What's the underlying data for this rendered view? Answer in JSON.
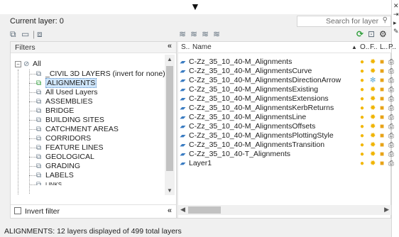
{
  "header": {
    "current_layer": "Current layer: 0",
    "search_placeholder": "Search for layer"
  },
  "filters": {
    "title": "Filters",
    "collapse": "«",
    "invert_filter": "Invert filter",
    "items": [
      {
        "label": "All"
      },
      {
        "label": "_CIVIL 3D LAYERS (invert for none)"
      },
      {
        "label": "ALIGNMENTS"
      },
      {
        "label": "All Used Layers"
      },
      {
        "label": "ASSEMBLIES"
      },
      {
        "label": "BRIDGE"
      },
      {
        "label": "BUILDING SITES"
      },
      {
        "label": "CATCHMENT AREAS"
      },
      {
        "label": "CORRIDORS"
      },
      {
        "label": "FEATURE LINES"
      },
      {
        "label": "GEOLOGICAL"
      },
      {
        "label": "GRADING"
      },
      {
        "label": "LABELS"
      },
      {
        "label": "LINKS"
      }
    ]
  },
  "layers": {
    "columns": {
      "status": "S..",
      "name": "Name",
      "on": "O..",
      "freeze": "F..",
      "lock": "L..",
      "plot": "P.."
    },
    "rows": [
      {
        "name": "C-Zz_35_10_40-M_Alignments",
        "frozen": false
      },
      {
        "name": "C-Zz_35_10_40-M_AlignmentsCurve",
        "frozen": false
      },
      {
        "name": "C-Zz_35_10_40-M_AlignmentsDirectionArrow",
        "frozen": true
      },
      {
        "name": "C-Zz_35_10_40-M_AlignmentsExisting",
        "frozen": false
      },
      {
        "name": "C-Zz_35_10_40-M_AlignmentsExtensions",
        "frozen": false
      },
      {
        "name": "C-Zz_35_10_40-M_AlignmentsKerbReturns",
        "frozen": false
      },
      {
        "name": "C-Zz_35_10_40-M_AlignmentsLine",
        "frozen": false
      },
      {
        "name": "C-Zz_35_10_40-M_AlignmentsOffsets",
        "frozen": false
      },
      {
        "name": "C-Zz_35_10_40-M_AlignmentsPlottingStyle",
        "frozen": false
      },
      {
        "name": "C-Zz_35_10_40-M_AlignmentsTransition",
        "frozen": false
      },
      {
        "name": "C-Zz_35_10_40-T_Alignments",
        "frozen": false
      },
      {
        "name": "Layer1",
        "frozen": false
      }
    ]
  },
  "status_bar": {
    "text": "ALIGNMENTS: 12 layers displayed of 499 total layers"
  },
  "icons": {
    "layer_status": "layer-status-icon",
    "bulb": "bulb-on-icon",
    "sun": "thawed-sun-icon",
    "snow": "frozen-snowflake-icon",
    "lock": "unlocked-icon",
    "plot": "printer-icon"
  },
  "colors": {
    "selection": "#cfe6fb",
    "bulb": "#f2b705",
    "freeze_vp": "#5aa7d6",
    "refresh": "#2e9e3a"
  }
}
